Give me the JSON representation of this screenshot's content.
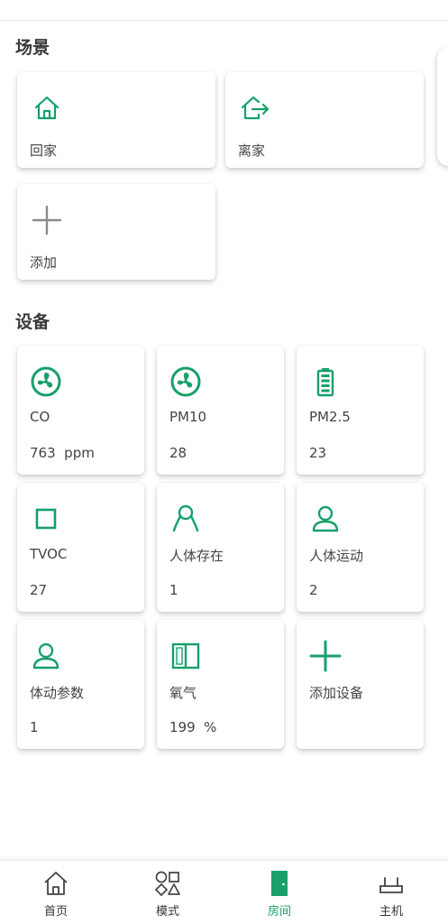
{
  "colors": {
    "accent": "#17a06a",
    "muted_icon": "#8a8a8a",
    "text": "#444444"
  },
  "scenes": {
    "title": "场景",
    "items": [
      {
        "label": "回家",
        "icon": "home-icon"
      },
      {
        "label": "离家",
        "icon": "leave-home-icon"
      },
      {
        "label": "添加",
        "icon": "add-icon"
      }
    ]
  },
  "devices": {
    "title": "设备",
    "items": [
      {
        "label": "CO",
        "value": "763  ppm",
        "icon": "fan-icon"
      },
      {
        "label": "PM10",
        "value": "28",
        "icon": "fan-icon"
      },
      {
        "label": "PM2.5",
        "value": "23",
        "icon": "battery-icon"
      },
      {
        "label": "TVOC",
        "value": "27",
        "icon": "square-icon"
      },
      {
        "label": "人体存在",
        "value": "1",
        "icon": "person-outline-icon"
      },
      {
        "label": "人体运动",
        "value": "2",
        "icon": "person-icon"
      },
      {
        "label": "体动参数",
        "value": "1",
        "icon": "person-icon"
      },
      {
        "label": "氧气",
        "value": "199  %",
        "icon": "window-icon"
      },
      {
        "label": "添加设备",
        "value": "",
        "icon": "add-icon"
      }
    ]
  },
  "nav": {
    "items": [
      {
        "label": "首页",
        "icon": "home-nav-icon",
        "active": false
      },
      {
        "label": "模式",
        "icon": "modes-icon",
        "active": false
      },
      {
        "label": "房间",
        "icon": "door-icon",
        "active": true
      },
      {
        "label": "主机",
        "icon": "router-icon",
        "active": false
      }
    ]
  }
}
